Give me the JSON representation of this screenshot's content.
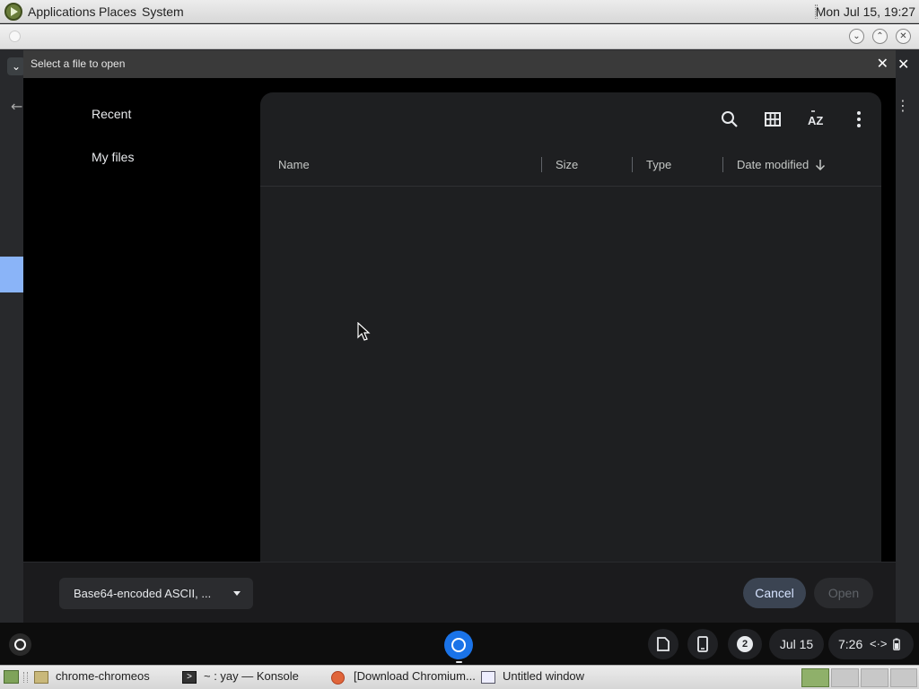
{
  "top_panel": {
    "menus": [
      "Applications",
      "Places",
      "System"
    ],
    "clock": "Mon Jul 15, 19:27"
  },
  "dialog": {
    "title": "Select a file to open",
    "nav": {
      "recent": "Recent",
      "my_files": "My files"
    },
    "columns": {
      "name": "Name",
      "size": "Size",
      "type": "Type",
      "date": "Date modified"
    },
    "sort": "Date modified, descending",
    "filetype": "Base64-encoded ASCII, ...",
    "buttons": {
      "cancel": "Cancel",
      "open": "Open"
    }
  },
  "shelf": {
    "notification_count": "2",
    "date": "Jul 15",
    "time": "7:26"
  },
  "taskbar": {
    "items": [
      "chrome-chromeos",
      "~ : yay — Konsole",
      "[Download Chromium...",
      "Untitled window"
    ]
  }
}
